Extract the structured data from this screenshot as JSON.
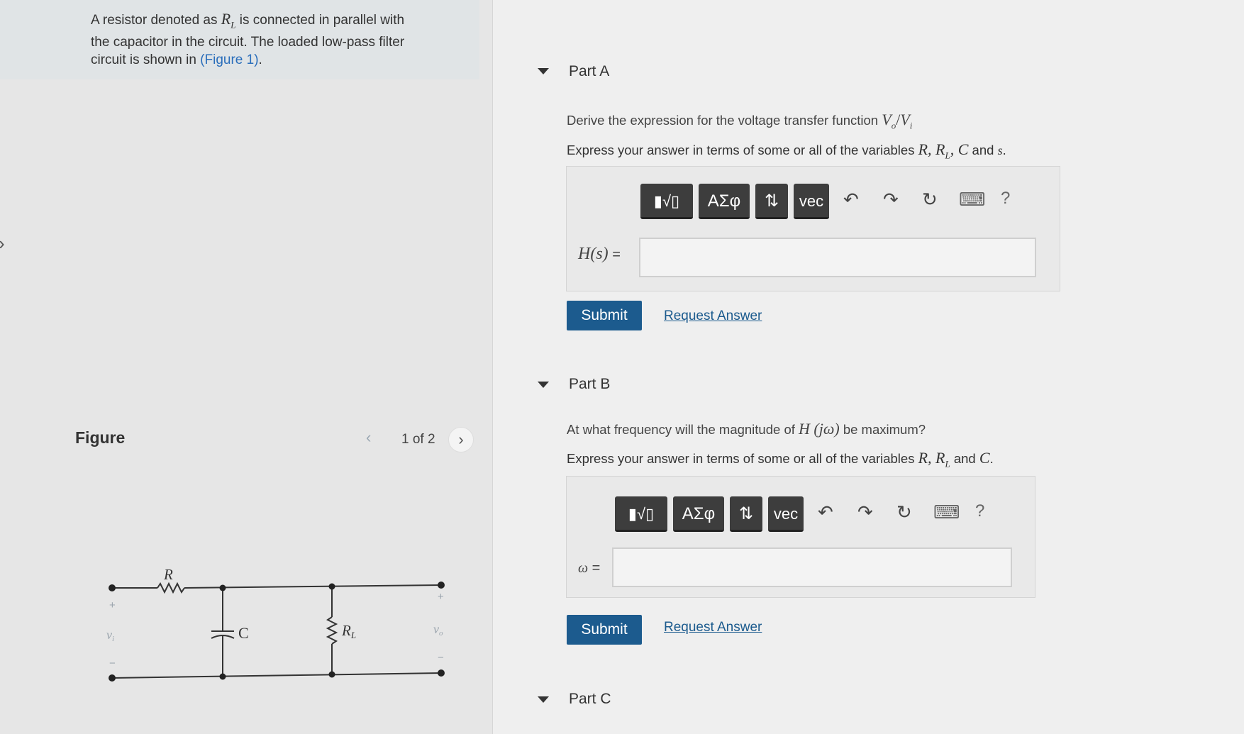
{
  "intro": {
    "line1_pre": "A resistor denoted as ",
    "var": "R",
    "var_sub": "L",
    "line1_post": " is connected in parallel with",
    "line2": "the capacitor in the circuit. The loaded low-pass filter",
    "line3_pre": "circuit is shown in ",
    "link": "(Figure 1)",
    "line3_post": "."
  },
  "figure": {
    "title": "Figure",
    "prev_icon": "chevron-left-icon",
    "next_icon": "chevron-right-icon",
    "count": "1 of 2",
    "labels": {
      "R": "R",
      "C": "C",
      "RL_main": "R",
      "RL_sub": "L",
      "vi": "v",
      "vi_sub": "i",
      "vo": "v",
      "vo_sub": "o",
      "plus": "+",
      "minus": "−"
    }
  },
  "partA": {
    "title": "Part A",
    "question": "Derive the expression for the voltage transfer function ",
    "question_math": "V",
    "question_math_sub": "o",
    "question_math_slash": "/",
    "question_math2": "V",
    "question_math2_sub": "i",
    "express_pre": "Express your answer in terms of some or all of the variables ",
    "express_vars": "R, R",
    "express_vars_sub": "L",
    "express_vars_post": ", C",
    "express_and": " and ",
    "express_last": "s",
    "express_end": ".",
    "field_label": "H(s)",
    "field_eq": " =",
    "input_value": "",
    "submit": "Submit",
    "request": "Request Answer"
  },
  "partB": {
    "title": "Part B",
    "question_pre": "At what frequency will the magnitude of ",
    "question_math": "H (jω)",
    "question_post": " be maximum?",
    "express_pre": "Express your answer in terms of some or all of the variables ",
    "express_vars": "R, R",
    "express_vars_sub": "L",
    "express_and": " and ",
    "express_last": "C",
    "express_end": ".",
    "field_label": "ω",
    "field_eq": " =",
    "input_value": "",
    "submit": "Submit",
    "request": "Request Answer"
  },
  "partC": {
    "title": "Part C"
  },
  "toolbar": {
    "templates": "▮√▯",
    "greek": "ΑΣφ",
    "arrows": "⇅",
    "vec": "vec",
    "undo": "↶",
    "redo": "↷",
    "reset": "↻",
    "keyboard": "⌨",
    "help": "?"
  },
  "colors": {
    "submit_bg": "#1c5b8e",
    "link": "#1c5b8e",
    "toolbar_bg": "#3d3d3d"
  }
}
